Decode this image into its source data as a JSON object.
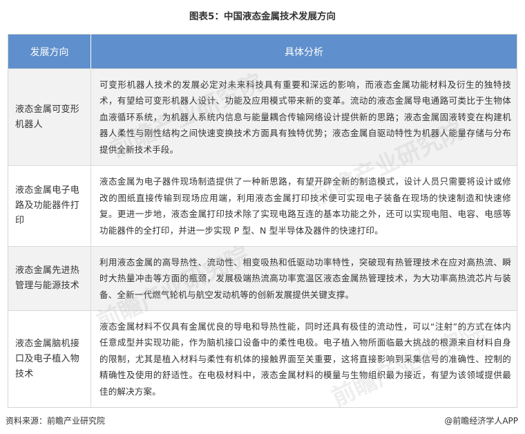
{
  "title": "图表5：中国液态金属技术发展方向",
  "table": {
    "headers": [
      "发展方向",
      "具体分析"
    ],
    "rows": [
      {
        "direction": "液态金属可变形机器人",
        "analysis": "可变形机器人技术的发展必定对未来科技具有重要和深远的影响，而液态金属功能材料及衍生的独特技术，有望给可变形机器人设计、功能及应用模式带来新的变革。流动的液态金属导电通路可类比于生物体血液循环系统，为机器人系统内信息与能量耦合传输网络设计提供新的思路；液态金属固液转变在构建机器人柔性与刚性结构之间快速变换技术方面具有独特优势；液态金属自驱动特性为机器人能量存储与分布提供全新技术手段。"
      },
      {
        "direction": "液态金属电子电路及功能器件打印",
        "analysis": "液态金属为电子器件现场制造提供了一种新思路，有望开辟全新的制造模式，设计人员只需要将设计或修改的图纸直接传输到现场应用端，利用液态金属打印技术便可实现电子装备在现场的快速制造和快速修复。更进一步地，液态金属打印技术除了实现电路互连的基本功能之外，还可以实现电阻、电容、电感等功能器件的全打印，并进一步实现 P 型、N 型半导体及器件的快速打印。"
      },
      {
        "direction": "液态金属先进热管理与能源技术",
        "analysis": "利用液态金属的高导热性、流动性、相变吸热和低驱动功率特性，突破现有热管理技术在应对高热流、瞬时大热量冲击等方面的瓶颈，发展极端热流高功率宽温区液态金属热管理技术，为大功率高热流芯片与装备、全新一代燃气轮机与航空发动机等的创新发展提供关键支撑。"
      },
      {
        "direction": "液态金属脑机接口及电子植入物技术",
        "analysis": "液态金属材料不仅具有金属优良的导电和导热性能，同时还具有极佳的流动性，可以“注射”的方式在体内任意成型并实现功能，作为脑机接口设备中的柔性电极。电子植入物所面临最大挑战的根源来自材料自身的限制，尤其是植入材料与柔性有机体的接触界面至关重要，这将直接影响到采集信号的准确性、控制的精确性及使用的舒适性。在电极材料中，液态金属材料的模量与生物组织最为接近，有望为该领域提供最佳的解决方案。"
      }
    ]
  },
  "footer": {
    "source": "资料来源：前瞻产业研究院",
    "brand": "@前瞻经济学人APP"
  },
  "watermark": {
    "text": "前瞻产业研究院"
  },
  "colors": {
    "header_bg": "#5f8fcc",
    "zebra_bg": "#f2f2f2"
  }
}
